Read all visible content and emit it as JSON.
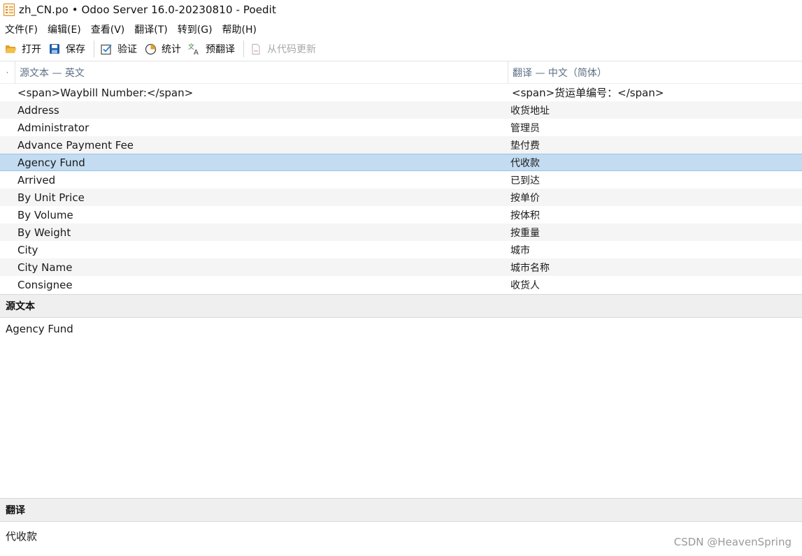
{
  "window": {
    "title": "zh_CN.po • Odoo Server 16.0-20230810 - Poedit"
  },
  "menu": [
    {
      "label": "文件(F)"
    },
    {
      "label": "编辑(E)"
    },
    {
      "label": "查看(V)"
    },
    {
      "label": "翻译(T)"
    },
    {
      "label": "转到(G)"
    },
    {
      "label": "帮助(H)"
    }
  ],
  "toolbar": {
    "open": {
      "label": "打开",
      "icon": "folder-open-icon"
    },
    "save": {
      "label": "保存",
      "icon": "save-icon"
    },
    "validate": {
      "label": "验证",
      "icon": "checkbox-icon"
    },
    "stats": {
      "label": "统计",
      "icon": "pie-chart-icon"
    },
    "pretranslate": {
      "label": "预翻译",
      "icon": "translate-icon"
    },
    "update_from_code": {
      "label": "从代码更新",
      "icon": "document-icon",
      "disabled": true
    }
  },
  "list": {
    "header": {
      "dot": "·",
      "source": "源文本 — 英文",
      "translation": "翻译 — 中文（简体）"
    },
    "rows": [
      {
        "source": "<span>Waybill Number:</span>",
        "translation": "<span>货运单编号：</span>"
      },
      {
        "source": "Address",
        "translation": "收货地址"
      },
      {
        "source": "Administrator",
        "translation": "管理员"
      },
      {
        "source": "Advance Payment Fee",
        "translation": "垫付费"
      },
      {
        "source": "Agency Fund",
        "translation": "代收款"
      },
      {
        "source": "Arrived",
        "translation": "已到达"
      },
      {
        "source": "By Unit Price",
        "translation": "按单价"
      },
      {
        "source": "By Volume",
        "translation": "按体积"
      },
      {
        "source": "By Weight",
        "translation": "按重量"
      },
      {
        "source": "City",
        "translation": "城市"
      },
      {
        "source": "City Name",
        "translation": "城市名称"
      },
      {
        "source": "Consignee",
        "translation": "收货人"
      }
    ],
    "selected_index": 4
  },
  "source_panel": {
    "title": "源文本",
    "text": "Agency Fund"
  },
  "translation_panel": {
    "title": "翻译",
    "text": "代收款"
  },
  "watermark": "CSDN @HeavenSpring",
  "colors": {
    "selection": "#c3dcf1",
    "header_text": "#5b6f86",
    "panel_bg": "#efefef"
  }
}
